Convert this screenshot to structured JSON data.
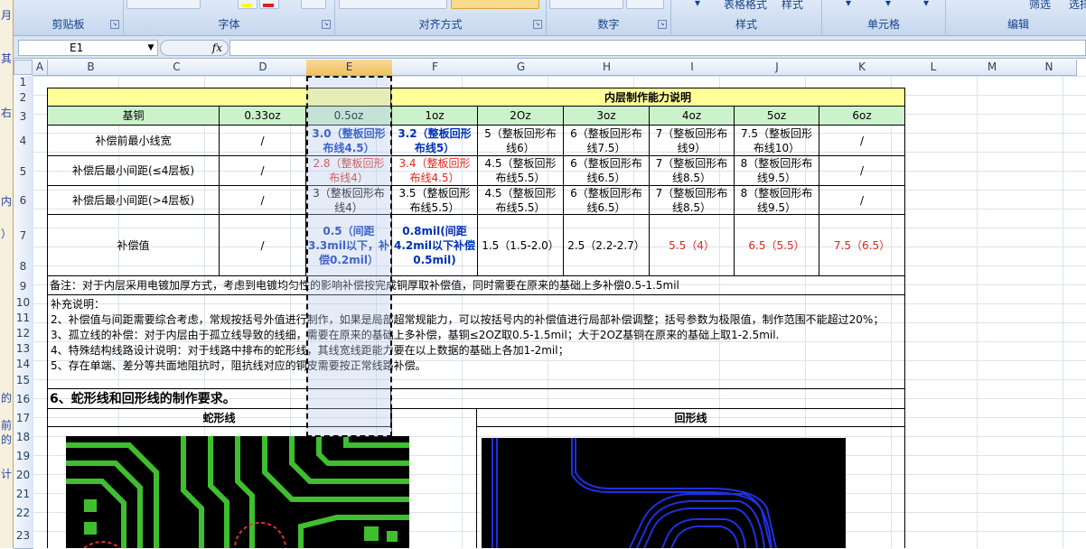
{
  "ribbon": {
    "groups": [
      {
        "label": "剪贴板"
      },
      {
        "label": "字体"
      },
      {
        "label": "对齐方式"
      },
      {
        "label": "数字"
      },
      {
        "label": "样式"
      },
      {
        "label": "单元格"
      },
      {
        "label": "编辑"
      }
    ],
    "style_buttons": {
      "table_format": "表格格式",
      "cell_style": "样式"
    },
    "filter_label": "筛选",
    "find_label": "选择",
    "font_color_swatch": "#e02020",
    "highlight_swatch": "#ffff00"
  },
  "left_strip": {
    "chars": [
      "月",
      "其",
      "右",
      "内",
      "）",
      "的",
      "前",
      "的",
      "计"
    ]
  },
  "formula_bar": {
    "name_box": "E1",
    "fx": "fx",
    "formula": ""
  },
  "columns": [
    "A",
    "B",
    "C",
    "D",
    "E",
    "F",
    "G",
    "H",
    "I",
    "J",
    "K",
    "L",
    "M",
    "N"
  ],
  "selected_column": "E",
  "rows": [
    "1",
    "2",
    "3",
    "4",
    "5",
    "6",
    "7",
    "8",
    "9",
    "10",
    "11",
    "12",
    "13",
    "14",
    "15",
    "16",
    "17",
    "18",
    "19",
    "20",
    "21",
    "22",
    "23"
  ],
  "sheet": {
    "title": "内层制作能力说明",
    "header": [
      "基铜",
      "0.33oz",
      "0.5oz",
      "1oz",
      "2Oz",
      "3oz",
      "4oz",
      "5oz",
      "6oz"
    ],
    "rows": [
      [
        "补偿前最小线宽",
        "/",
        "3.0（整板回形布线4.5）",
        "3.2（整板回形布线5）",
        "5（整板回形布线6）",
        "6（整板回形布线7.5）",
        "7（整板回形布线9）",
        "7.5（整板回形布线10）",
        "/"
      ],
      [
        "补偿后最小间距(≤4层板)",
        "/",
        "2.8（整板回形布线4）",
        "3.4（整板回形布线4.5）",
        "4.5（整板回形布线5.5）",
        "6（整板回形布线6.5）",
        "7（整板回形布线8.5）",
        "8（整板回形布线9.5）",
        "/"
      ],
      [
        "补偿后最小间距(>4层板)",
        "/",
        "3（整板回形布线4）",
        "3.5（整板回形布线5.5）",
        "4.5（整板回形布线5.5）",
        "6（整板回形布线6.5）",
        "7（整板回形布线8.5）",
        "8（整板回形布线9.5）",
        "/"
      ],
      [
        "补偿值",
        "/",
        "0.5（间距3.3mil以下，补偿0.2mil）",
        "0.8mil(间距4.2mil以下补偿0.5mil)",
        "1.5（1.5-2.0）",
        "2.5（2.2-2.7）",
        "5.5（4）",
        "6.5（5.5）",
        "7.5（6.5）"
      ]
    ],
    "remark": "备注：对于内层采用电镀加厚方式，考虑到电镀均匀性的影响补偿按完成铜厚取补偿值，同时需要在原来的基础上多补偿0.5-1.5mil",
    "notes": [
      "补充说明：",
      "2、补偿值与间距需要综合考虑，常规按括号外值进行制作，如果是局部超常规能力，可以按括号内的补偿值进行局部补偿调整；括号参数为极限值，制作范围不能超过20%；",
      "3、孤立线的补偿：对于内层由于孤立线导致的线细，需要在原来的基础上多补偿，基铜≤2OZ取0.5-1.5mil；大于2OZ基铜在原来的基础上取1-2.5mil.",
      "4、特殊结构线路设计说明：对于线路中排布的蛇形线，其线宽线距能力要在以上数据的基础上各加1-2mil；",
      "5、存在单端、差分等共面地阻抗时，阻抗线对应的铜皮需要按正常线路补偿。"
    ],
    "section6": "6、蛇形线和回形线的制作要求。",
    "serpentine_label": "蛇形线",
    "loop_label": "回形线"
  },
  "colors": {
    "header_green": "#ccf2cc",
    "title_yellow": "#ffff99",
    "blue_text": "#002fb5",
    "red_text": "#e0261a"
  }
}
